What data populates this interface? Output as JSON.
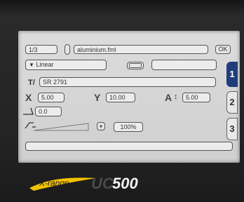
{
  "header": {
    "page_counter": "1/3",
    "file_name": "aluminium.fml",
    "ok_label": "OK"
  },
  "mode": {
    "selected": "Linear",
    "text_value": ""
  },
  "text_field": {
    "value": "SR 2791"
  },
  "coords": {
    "x_label": "X",
    "x_value": "5.00",
    "y_label": "Y",
    "y_value": "10.00",
    "a_label": "A",
    "a_value": "5.00",
    "angle_value": "0.0"
  },
  "power": {
    "value": "100%",
    "plus_label": "+"
  },
  "tabs": [
    "1",
    "2",
    "3"
  ],
  "brand": {
    "x_text": "X-range",
    "uc_text": "UC",
    "num_text": "500"
  },
  "colors": {
    "accent": "#1f3d7a",
    "brand_yellow": "#f2c200"
  }
}
